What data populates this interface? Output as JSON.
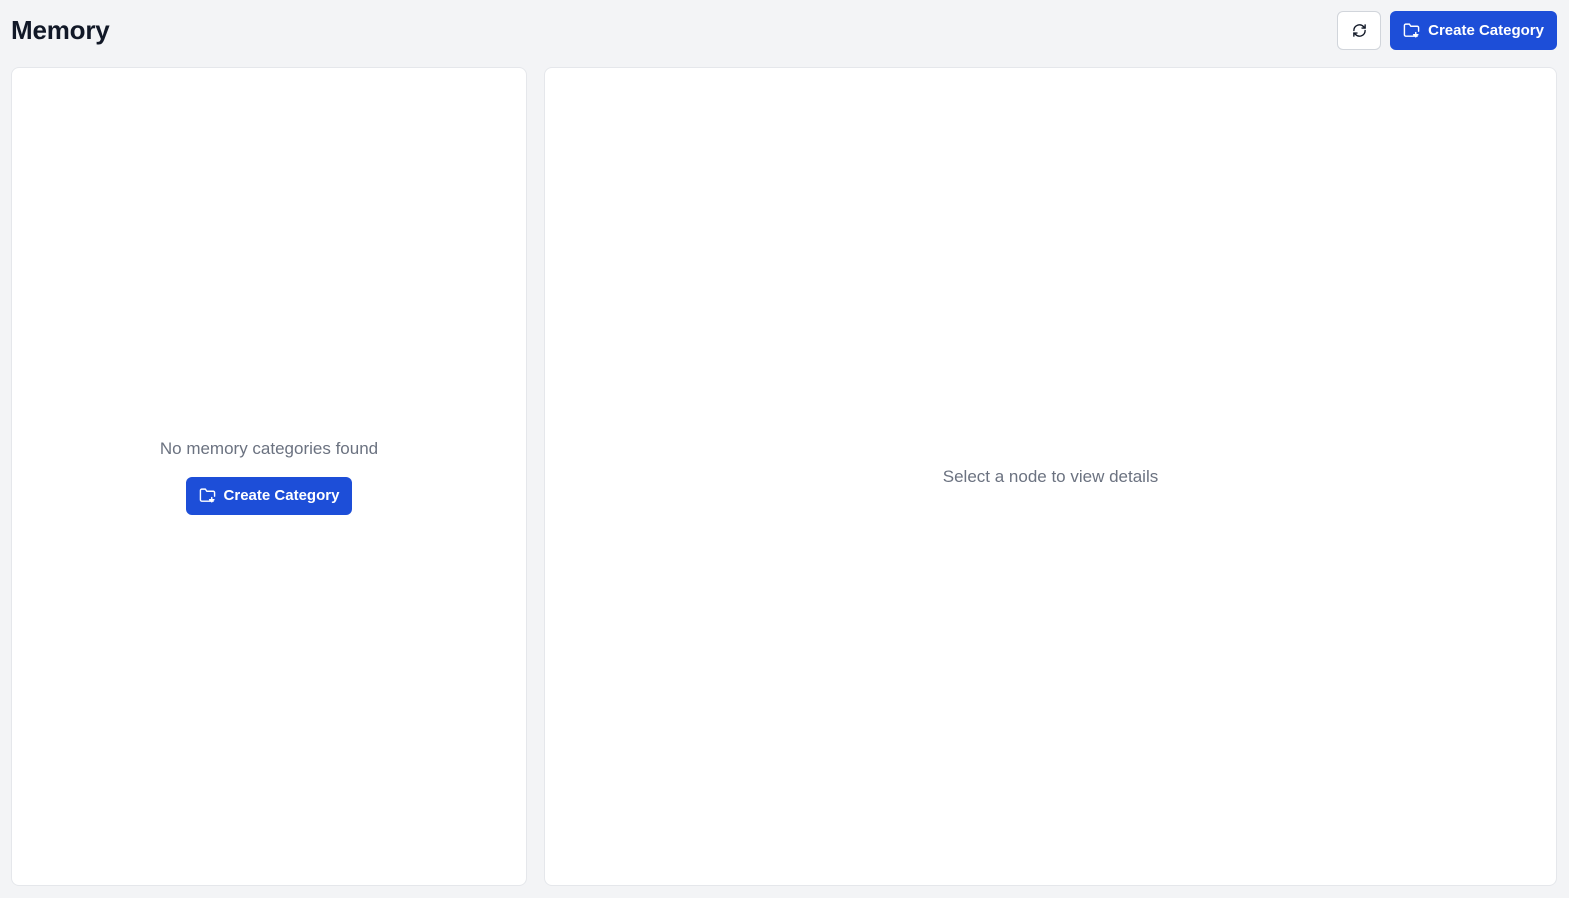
{
  "header": {
    "title": "Memory",
    "refresh_icon": "refresh-icon",
    "create_label": "Create Category",
    "create_icon": "folder-plus-icon"
  },
  "tree_panel": {
    "empty_message": "No memory categories found",
    "create_label": "Create Category",
    "create_icon": "folder-plus-icon"
  },
  "details_panel": {
    "placeholder": "Select a node to view details"
  },
  "colors": {
    "background": "#f3f4f6",
    "panel": "#ffffff",
    "primary": "#1d4ed8",
    "muted_text": "#6b7280",
    "title_text": "#111827"
  }
}
